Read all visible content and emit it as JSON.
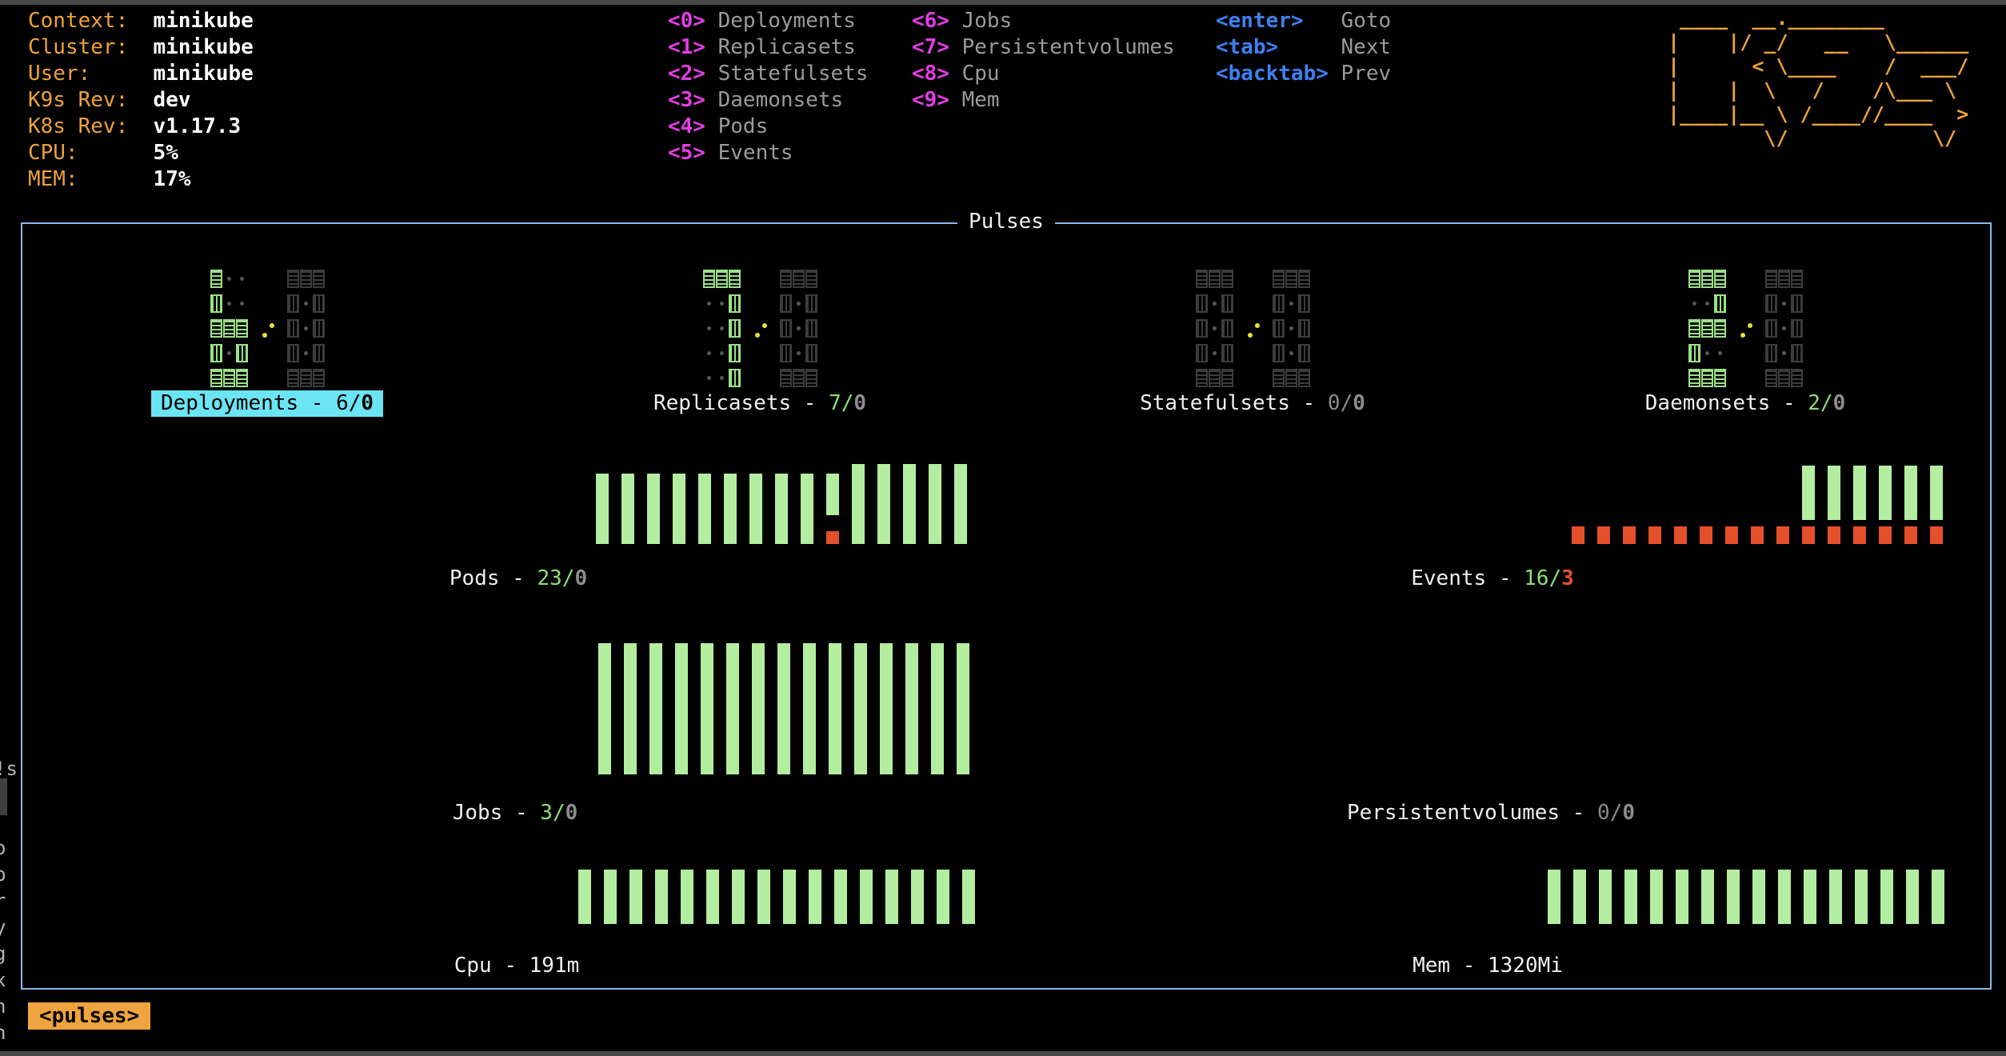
{
  "header": {
    "cluster_info": [
      {
        "label": "Context:",
        "value": "minikube"
      },
      {
        "label": "Cluster:",
        "value": "minikube"
      },
      {
        "label": "User:",
        "value": "minikube"
      },
      {
        "label": "K9s Rev:",
        "value": "dev"
      },
      {
        "label": "K8s Rev:",
        "value": "v1.17.3"
      },
      {
        "label": "CPU:",
        "value": "5%"
      },
      {
        "label": "MEM:",
        "value": "17%"
      }
    ],
    "menu_columns": [
      {
        "key_style": "magenta",
        "items": [
          {
            "key": "<0>",
            "label": "Deployments"
          },
          {
            "key": "<1>",
            "label": "Replicasets"
          },
          {
            "key": "<2>",
            "label": "Statefulsets"
          },
          {
            "key": "<3>",
            "label": "Daemonsets"
          },
          {
            "key": "<4>",
            "label": "Pods"
          },
          {
            "key": "<5>",
            "label": "Events"
          }
        ]
      },
      {
        "key_style": "magenta",
        "items": [
          {
            "key": "<6>",
            "label": "Jobs"
          },
          {
            "key": "<7>",
            "label": "Persistentvolumes"
          },
          {
            "key": "<8>",
            "label": "Cpu"
          },
          {
            "key": "<9>",
            "label": "Mem"
          }
        ]
      },
      {
        "key_style": "blue",
        "items": [
          {
            "key": "<enter>",
            "label": "Goto"
          },
          {
            "key": "<tab>",
            "label": "Next"
          },
          {
            "key": "<backtab>",
            "label": "Prev"
          }
        ]
      }
    ],
    "logo_lines": [
      " ____  __.________       ",
      "|    |/ _/   __   \\______",
      "|      < \\____    /  ___/",
      "|    |  \\   /    /\\___ \\ ",
      "|____|__ \\ /____//____  >",
      "        \\/            \\/ "
    ]
  },
  "pulses": {
    "title": "Pulses",
    "gauges": [
      {
        "name": "Deployments",
        "ok": "6",
        "fault": "0",
        "selected": true
      },
      {
        "name": "Replicasets",
        "ok": "7",
        "fault": "0",
        "selected": false
      },
      {
        "name": "Statefulsets",
        "ok": "0",
        "fault": "0",
        "selected": false
      },
      {
        "name": "Daemonsets",
        "ok": "2",
        "fault": "0",
        "selected": false
      }
    ],
    "charts": {
      "pods": {
        "name": "Pods",
        "ok": "23",
        "fault": "0",
        "bars": [
          [
            88,
            88,
            0
          ],
          [
            88,
            88,
            0
          ],
          [
            88,
            88,
            0
          ],
          [
            88,
            88,
            0
          ],
          [
            88,
            88,
            0
          ],
          [
            88,
            88,
            0
          ],
          [
            88,
            88,
            0
          ],
          [
            88,
            88,
            0
          ],
          [
            88,
            88,
            0
          ],
          [
            88,
            52,
            16
          ],
          [
            100,
            100,
            0
          ],
          [
            100,
            100,
            0
          ],
          [
            100,
            100,
            0
          ],
          [
            100,
            100,
            0
          ],
          [
            100,
            100,
            0
          ]
        ]
      },
      "events": {
        "name": "Events",
        "ok": "16",
        "fault": "3",
        "bars": [
          [
            22,
            0,
            22
          ],
          [
            22,
            0,
            22
          ],
          [
            22,
            0,
            22
          ],
          [
            22,
            0,
            22
          ],
          [
            22,
            0,
            22
          ],
          [
            22,
            0,
            22
          ],
          [
            22,
            0,
            22
          ],
          [
            22,
            0,
            22
          ],
          [
            22,
            0,
            22
          ],
          [
            98,
            68,
            22
          ],
          [
            98,
            68,
            22
          ],
          [
            98,
            68,
            22
          ],
          [
            98,
            68,
            22
          ],
          [
            98,
            68,
            22
          ],
          [
            98,
            68,
            22
          ]
        ]
      },
      "jobs": {
        "name": "Jobs",
        "ok": "3",
        "fault": "0",
        "bars": [
          [
            164,
            164,
            0
          ],
          [
            164,
            164,
            0
          ],
          [
            164,
            164,
            0
          ],
          [
            164,
            164,
            0
          ],
          [
            164,
            164,
            0
          ],
          [
            164,
            164,
            0
          ],
          [
            164,
            164,
            0
          ],
          [
            164,
            164,
            0
          ],
          [
            164,
            164,
            0
          ],
          [
            164,
            164,
            0
          ],
          [
            164,
            164,
            0
          ],
          [
            164,
            164,
            0
          ],
          [
            164,
            164,
            0
          ],
          [
            164,
            164,
            0
          ],
          [
            164,
            164,
            0
          ]
        ]
      },
      "persistentvolumes": {
        "name": "Persistentvolumes",
        "ok": "0",
        "fault": "0",
        "bars": []
      },
      "cpu": {
        "name": "Cpu",
        "value": "191m",
        "bars": [
          [
            68,
            68,
            0
          ],
          [
            68,
            68,
            0
          ],
          [
            68,
            68,
            0
          ],
          [
            68,
            68,
            0
          ],
          [
            68,
            68,
            0
          ],
          [
            68,
            68,
            0
          ],
          [
            68,
            68,
            0
          ],
          [
            68,
            68,
            0
          ],
          [
            68,
            68,
            0
          ],
          [
            68,
            68,
            0
          ],
          [
            68,
            68,
            0
          ],
          [
            68,
            68,
            0
          ],
          [
            68,
            68,
            0
          ],
          [
            68,
            68,
            0
          ],
          [
            68,
            68,
            0
          ],
          [
            68,
            68,
            0
          ]
        ]
      },
      "mem": {
        "name": "Mem",
        "value": "1320Mi",
        "bars": [
          [
            68,
            68,
            0
          ],
          [
            68,
            68,
            0
          ],
          [
            68,
            68,
            0
          ],
          [
            68,
            68,
            0
          ],
          [
            68,
            68,
            0
          ],
          [
            68,
            68,
            0
          ],
          [
            68,
            68,
            0
          ],
          [
            68,
            68,
            0
          ],
          [
            68,
            68,
            0
          ],
          [
            68,
            68,
            0
          ],
          [
            68,
            68,
            0
          ],
          [
            68,
            68,
            0
          ],
          [
            68,
            68,
            0
          ],
          [
            68,
            68,
            0
          ],
          [
            68,
            68,
            0
          ],
          [
            68,
            68,
            0
          ]
        ]
      }
    },
    "digit_patterns": {
      "0": [
        "hhh",
        "v.v",
        "v.v",
        "v.v",
        "hhh"
      ],
      "1": [
        "..v",
        "..v",
        "..v",
        "..v",
        "..v"
      ],
      "2": [
        "hhh",
        "..v",
        "hhh",
        "v..",
        "hhh"
      ],
      "3": [
        "hhh",
        "..v",
        "hhh",
        "..v",
        "hhh"
      ],
      "4": [
        "v.v",
        "v.v",
        "hhh",
        "..v",
        "..v"
      ],
      "5": [
        "hhh",
        "v..",
        "hhh",
        "..v",
        "hhh"
      ],
      "6": [
        "h..",
        "v..",
        "hhh",
        "v.v",
        "hhh"
      ],
      "7": [
        "hhh",
        "..v",
        "..v",
        "..v",
        "..v"
      ],
      "8": [
        "hhh",
        "v.v",
        "hhh",
        "v.v",
        "hhh"
      ],
      "9": [
        "hhh",
        "v.v",
        "hhh",
        "..v",
        "hhh"
      ]
    }
  },
  "footer": {
    "crumb": "<pulses>"
  },
  "side_strip": {
    "glyphs": [
      "!s",
      "",
      "",
      "o",
      "b",
      "r",
      "y",
      "g",
      "x",
      "n",
      "n"
    ]
  },
  "colors": {
    "orange": "#eda13b",
    "magenta": "#e23ee2",
    "blue": "#3e80ef",
    "gray_label": "#9a9a9a",
    "white": "#f0f0f0",
    "green_digit": "#9be089",
    "green_text": "#8ede79",
    "bar_green": "#b3eda0",
    "red": "#e4502a",
    "value_gray": "#8c8c8c",
    "block_off": "#3c3c3c",
    "dim": "#565656",
    "yellow": "#e6e33b",
    "cyan_bg": "#6be4f3",
    "border": "#8ab8ea",
    "badge_bg": "#efa33e"
  }
}
